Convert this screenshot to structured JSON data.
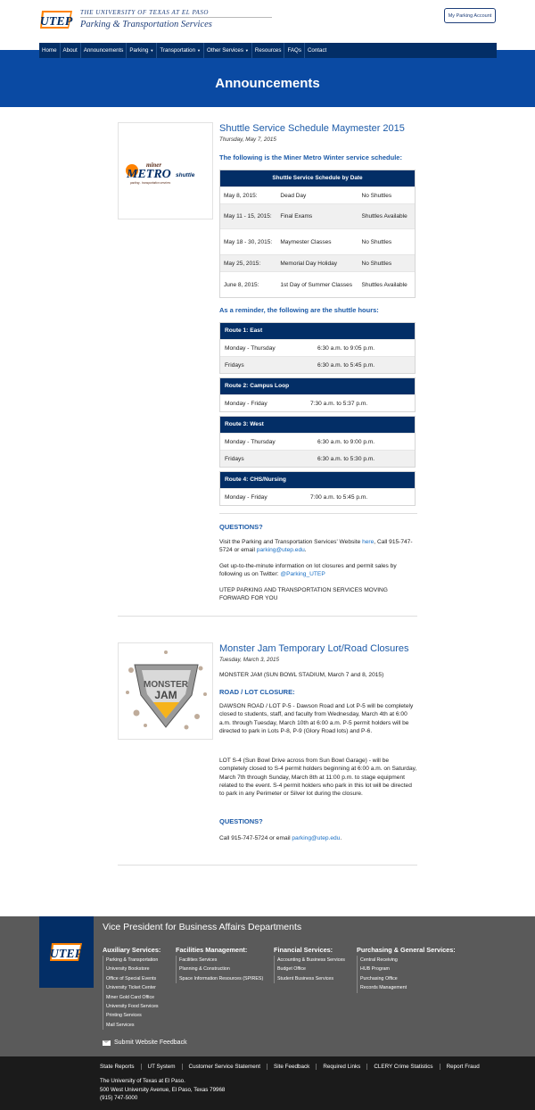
{
  "header": {
    "university": "THE UNIVERSITY OF TEXAS AT EL PASO",
    "department": "Parking & Transportation Services",
    "account_button": "My Parking Account"
  },
  "nav": [
    {
      "label": "Home",
      "dropdown": false
    },
    {
      "label": "About",
      "dropdown": false
    },
    {
      "label": "Announcements",
      "dropdown": false
    },
    {
      "label": "Parking",
      "dropdown": true
    },
    {
      "label": "Transportation",
      "dropdown": true
    },
    {
      "label": "Other Services",
      "dropdown": true
    },
    {
      "label": "Resources",
      "dropdown": false
    },
    {
      "label": "FAQs",
      "dropdown": false
    },
    {
      "label": "Contact",
      "dropdown": false
    }
  ],
  "page_title": "Announcements",
  "post1": {
    "title": "Shuttle Service Schedule Maymester 2015",
    "date": "Thursday, May 7, 2015",
    "logo_top": "miner",
    "logo_main": "METRO",
    "logo_small": "shuttle",
    "logo_tag": "parking . transportation services",
    "intro": "The following is the Miner Metro Winter service schedule:",
    "schedule_header": "Shuttle Service Schedule by Date",
    "schedule": [
      {
        "date": "May 8, 2015:",
        "event": "Dead Day",
        "status": "No Shuttles"
      },
      {
        "date": "May 11 - 15, 2015:",
        "event": "Final Exams",
        "status": "Shuttles Available"
      },
      {
        "date": "May 18 - 30, 2015:",
        "event": "Maymester Classes",
        "status": "No Shuttles"
      },
      {
        "date": "May 25, 2015:",
        "event": "Memorial Day Holiday",
        "status": "No Shuttles"
      },
      {
        "date": "June 8, 2015:",
        "event": "1st Day of Summer Classes",
        "status": "Shuttles Available"
      }
    ],
    "reminder": "As a reminder, the following are the shuttle hours:",
    "routes": [
      {
        "name": "Route 1: East",
        "rows": [
          {
            "days": "Monday - Thursday",
            "hours": "6:30 a.m. to 9:05 p.m."
          },
          {
            "days": "Fridays",
            "hours": "6:30 a.m. to 5:45 p.m."
          }
        ]
      },
      {
        "name": "Route 2: Campus Loop",
        "rows": [
          {
            "days": "Monday - Friday",
            "hours": "7:30 a.m. to 5:37 p.m."
          }
        ]
      },
      {
        "name": "Route 3: West",
        "rows": [
          {
            "days": "Monday - Thursday",
            "hours": "6:30 a.m. to 9:00 p.m."
          },
          {
            "days": "Fridays",
            "hours": "6:30 a.m. to 5:30 p.m."
          }
        ]
      },
      {
        "name": "Route 4: CHS/Nursing",
        "rows": [
          {
            "days": "Monday - Friday",
            "hours": "7:00 a.m. to 5:45 p.m."
          }
        ]
      }
    ],
    "questions_heading": "QUESTIONS?",
    "q_text1": "Visit the Parking and Transportation Services' Website ",
    "q_link_here": "here",
    "q_text2": ", Call 915-747-5724 or email ",
    "q_email": "parking@utep.edu",
    "q_text3": ".",
    "twitter_text": "Get up-to-the-minute information on lot closures and permit sales by following us on Twitter: ",
    "twitter_handle": "@Parking_UTEP",
    "closing": "UTEP PARKING AND TRANSPORTATION SERVICES MOVING FORWARD FOR YOU"
  },
  "post2": {
    "title": "Monster Jam Temporary Lot/Road Closures",
    "date": "Tuesday, March 3, 2015",
    "logo_line1": "MONSTER",
    "logo_line2": "JAM",
    "subtitle": "MONSTER JAM (SUN BOWL STADIUM, March 7 and 8, 2015)",
    "road_heading": "ROAD / LOT CLOSURE:",
    "para1": "DAWSON ROAD / LOT P-5 - Dawson Road and Lot P-5 will be completely closed to students, staff, and faculty from Wednesday, March 4th at 6:00 a.m. through Tuesday, March 10th at 6:00 a.m. P-5 permit holders will be directed to park in Lots P-8, P-9 (Glory Road lots) and P-6.",
    "para2": "LOT S-4 (Sun Bowl Drive across from Sun Bowl Garage) - will be completely closed to S-4 permit holders beginning at 6:00 a.m. on Saturday, March 7th through Sunday, March 8th at 11:00 p.m. to stage equipment related to the event. S-4 permit holders who park in this lot will be directed to park in any Perimeter or Silver lot during the closure.",
    "questions_heading": "QUESTIONS?",
    "call_text": "Call 915-747-5724 or email ",
    "call_email": "parking@utep.edu",
    "call_end": "."
  },
  "footer": {
    "logo_text": "UTEP",
    "title": "Vice President for Business Affairs Departments",
    "columns": [
      {
        "heading": "Auxiliary Services:",
        "items": [
          "Parking & Transportation",
          "University Bookstore",
          "Office of Special Events",
          "University Ticket Center",
          "Miner Gold Card Office",
          "University Food Services",
          "Printing Services",
          "Mail Services"
        ]
      },
      {
        "heading": "Facilities Management:",
        "items": [
          "Facilities Services",
          "Planning & Construction",
          "Space Information Resources (SPIRES)"
        ]
      },
      {
        "heading": "Financial Services:",
        "items": [
          "Accounting & Business Services",
          "Budget Office",
          "Student Business Services"
        ]
      },
      {
        "heading": "Purchasing & General Services:",
        "items": [
          "Central Receiving",
          "HUB Program",
          "Purchasing Office",
          "Records Management"
        ]
      }
    ],
    "feedback": "Submit Website Feedback",
    "links": [
      "State Reports",
      "UT System",
      "Customer Service Statement",
      "Site Feedback",
      "Required Links",
      "CLERY Crime Statistics",
      "Report Fraud"
    ],
    "address": [
      "The University of Texas at El Paso.",
      "500 West University Avenue,  El Paso, Texas 79968",
      "(915) 747-5000"
    ]
  },
  "colors": {
    "navy": "#032e66",
    "hero_blue": "#0a4aa3",
    "link_blue": "#1a6fc4",
    "title_blue": "#1d5ba8",
    "footer_gray": "#5a5a5a",
    "bottom_black": "#1b1b1b",
    "utep_orange": "#ff8200"
  }
}
